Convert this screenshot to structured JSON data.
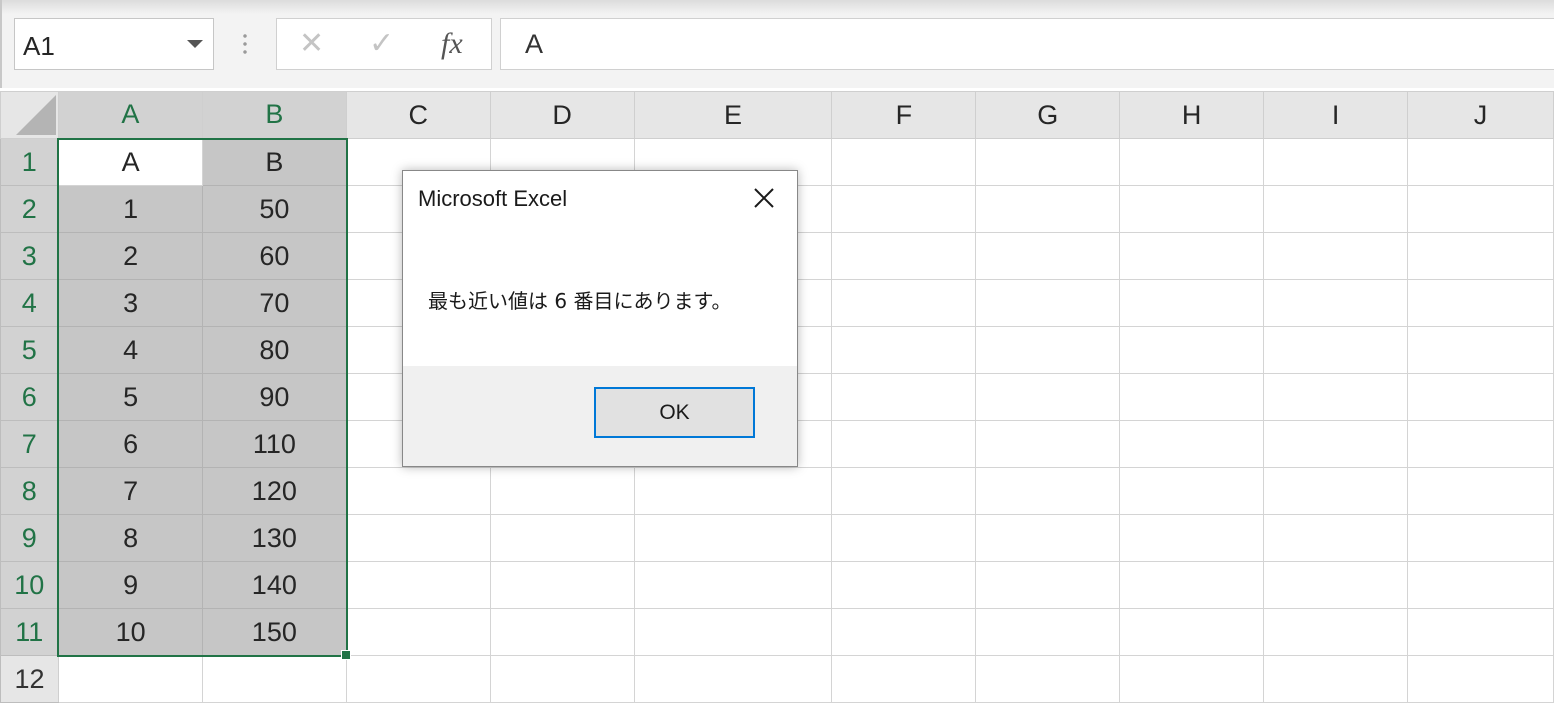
{
  "formula_bar": {
    "name_box": "A1",
    "cancel_glyph": "✕",
    "enter_glyph": "✓",
    "fx_label": "fx",
    "formula": "A"
  },
  "columns": [
    "A",
    "B",
    "C",
    "D",
    "E",
    "F",
    "G",
    "H",
    "I",
    "J"
  ],
  "rows": [
    {
      "num": "1",
      "a": "A",
      "b": "B"
    },
    {
      "num": "2",
      "a": "1",
      "b": "50"
    },
    {
      "num": "3",
      "a": "2",
      "b": "60"
    },
    {
      "num": "4",
      "a": "3",
      "b": "70"
    },
    {
      "num": "5",
      "a": "4",
      "b": "80"
    },
    {
      "num": "6",
      "a": "5",
      "b": "90"
    },
    {
      "num": "7",
      "a": "6",
      "b": "110"
    },
    {
      "num": "8",
      "a": "7",
      "b": "120"
    },
    {
      "num": "9",
      "a": "8",
      "b": "130"
    },
    {
      "num": "10",
      "a": "9",
      "b": "140"
    },
    {
      "num": "11",
      "a": "10",
      "b": "150"
    },
    {
      "num": "12",
      "a": "",
      "b": ""
    }
  ],
  "dialog": {
    "title": "Microsoft Excel",
    "message": "最も近い値は 6 番目にあります。",
    "ok_label": "OK",
    "close_icon": "close-icon"
  },
  "colors": {
    "excel_green": "#217346",
    "selection_fill": "#c6c6c6",
    "ok_focus": "#0078d7"
  }
}
